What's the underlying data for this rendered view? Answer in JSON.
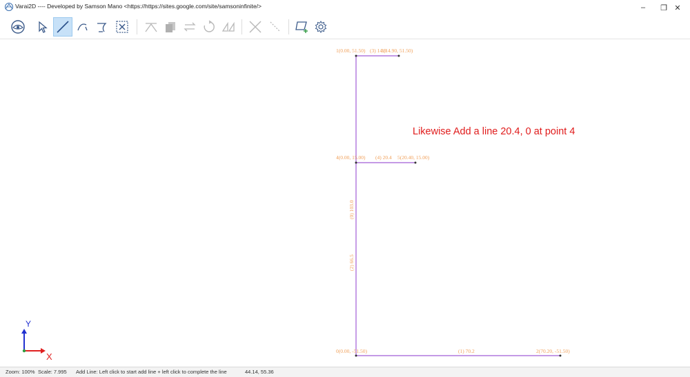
{
  "window": {
    "title": "Varai2D ---- Developed by Samson Mano <https://https://sites.google.com/site/samsoninfinite/>",
    "minimize": "–",
    "restore": "❐",
    "close": "✕"
  },
  "toolbar": {
    "tools": [
      {
        "name": "view-tool",
        "icon": "eye-circle-icon"
      },
      {
        "name": "select-tool",
        "icon": "pointer-icon"
      },
      {
        "name": "add-line-tool",
        "icon": "line-icon",
        "active": true
      },
      {
        "name": "add-arc-tool",
        "icon": "arc-icon"
      },
      {
        "name": "add-curve-tool",
        "icon": "curve-icon"
      },
      {
        "name": "select-box-tool",
        "icon": "box-select-icon"
      },
      {
        "name": "trim-tool",
        "icon": "trim-icon"
      },
      {
        "name": "copy-tool",
        "icon": "copy-icon"
      },
      {
        "name": "mirror-tool",
        "icon": "mirror-icon"
      },
      {
        "name": "rotate-tool",
        "icon": "rotate-icon"
      },
      {
        "name": "scale-tool",
        "icon": "scale-icon"
      },
      {
        "name": "delete-tool",
        "icon": "delete-x-icon"
      },
      {
        "name": "erase-tool",
        "icon": "erase-icon"
      },
      {
        "name": "add-region-tool",
        "icon": "region-add-icon"
      },
      {
        "name": "settings-tool",
        "icon": "gear-icon"
      }
    ]
  },
  "drawing": {
    "colors": {
      "line": "#a05cd6",
      "label": "#f0a05a",
      "annotation": "#e01b1b",
      "axis_x": "#e02020",
      "axis_y": "#2030d0"
    },
    "labels": {
      "p1": "1(0.00, 51.50)",
      "l3": "(3) 14.9",
      "p3": "3(14.90, 51.50)",
      "p4": "4(0.00, 15.00)",
      "l4": "(4) 20.4",
      "p5": "5(20.40, 15.00)",
      "l0": "(0) 103.0",
      "l2": "(2) 66.5",
      "p0": "0(0.00, -51.50)",
      "l1": "(1) 70.2",
      "p2": "2(70.20, -51.50)"
    },
    "axis": {
      "x": "X",
      "y": "Y"
    }
  },
  "annotation": "Likewise Add a line 20.4, 0 at point 4",
  "status": {
    "zoom": "Zoom: 100%",
    "scale": "Scale: 7.995",
    "mode": "Add Line: Left click to start add line + left click to complete the line",
    "coords": "44.14, 55.36"
  }
}
